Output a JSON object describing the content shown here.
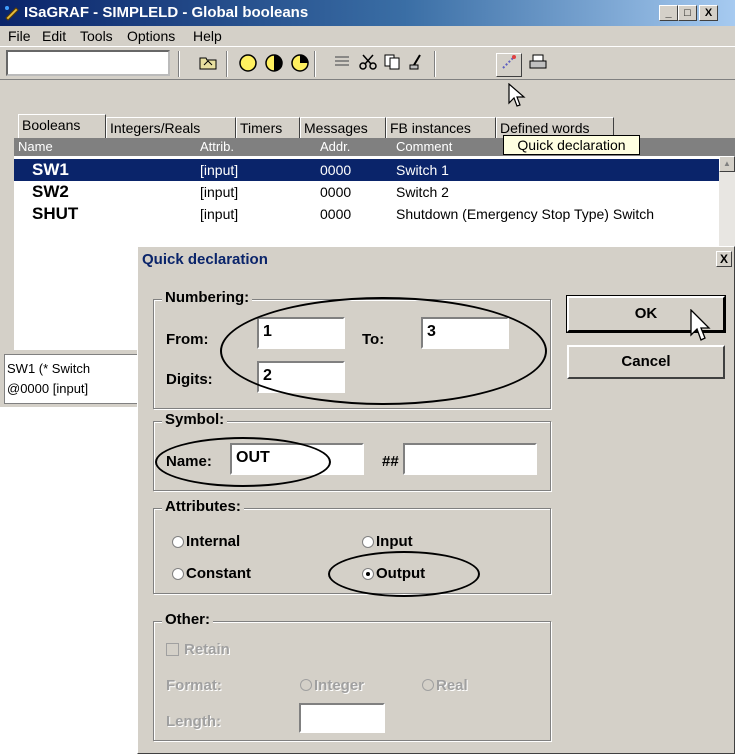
{
  "window": {
    "title": "ISaGRAF - SIMPLELD - Global booleans",
    "buttons": [
      "_",
      "□",
      "X"
    ]
  },
  "menu": [
    "File",
    "Edit",
    "Tools",
    "Options",
    "Help"
  ],
  "toolbar": {
    "combo_value": "",
    "tools": [
      "open-folder-icon",
      "circle-yellow-icon",
      "circle-half-icon",
      "circle-clock-icon",
      "list-icon",
      "scissors-icon",
      "copy-icon",
      "brush-icon",
      "quick-declaration-icon",
      "print-icon"
    ]
  },
  "tabs": [
    "Booleans",
    "Integers/Reals",
    "Timers",
    "Messages",
    "FB instances",
    "Defined words"
  ],
  "table": {
    "headers": [
      "Name",
      "Attrib.",
      "Addr.",
      "Comment"
    ],
    "rows": [
      {
        "name": "SW1",
        "attrib": "[input]",
        "addr": "0000",
        "comment": "Switch 1"
      },
      {
        "name": "SW2",
        "attrib": "[input]",
        "addr": "0000",
        "comment": "Switch 2"
      },
      {
        "name": "SHUT",
        "attrib": "[input]",
        "addr": "0000",
        "comment": "Shutdown (Emergency Stop Type) Switch"
      }
    ]
  },
  "tooltip": "Quick declaration",
  "info": {
    "line1": "SW1   (* Switch",
    "line2": "@0000  [input]"
  },
  "dialog": {
    "title": "Quick declaration",
    "close": "X",
    "numbering": {
      "legend": "Numbering:",
      "from_label": "From:",
      "from_value": "1",
      "to_label": "To:",
      "to_value": "3",
      "digits_label": "Digits:",
      "digits_value": "2"
    },
    "symbol": {
      "legend": "Symbol:",
      "name_label": "Name:",
      "name_value": "OUT",
      "suffix_label": "##",
      "suffix_value": ""
    },
    "attributes": {
      "legend": "Attributes:",
      "internal": "Internal",
      "input": "Input",
      "constant": "Constant",
      "output": "Output",
      "selected": "Output"
    },
    "other": {
      "legend": "Other:",
      "retain": "Retain",
      "format_label": "Format:",
      "integer": "Integer",
      "real": "Real",
      "length_label": "Length:",
      "length_value": ""
    },
    "ok": "OK",
    "cancel": "Cancel"
  }
}
